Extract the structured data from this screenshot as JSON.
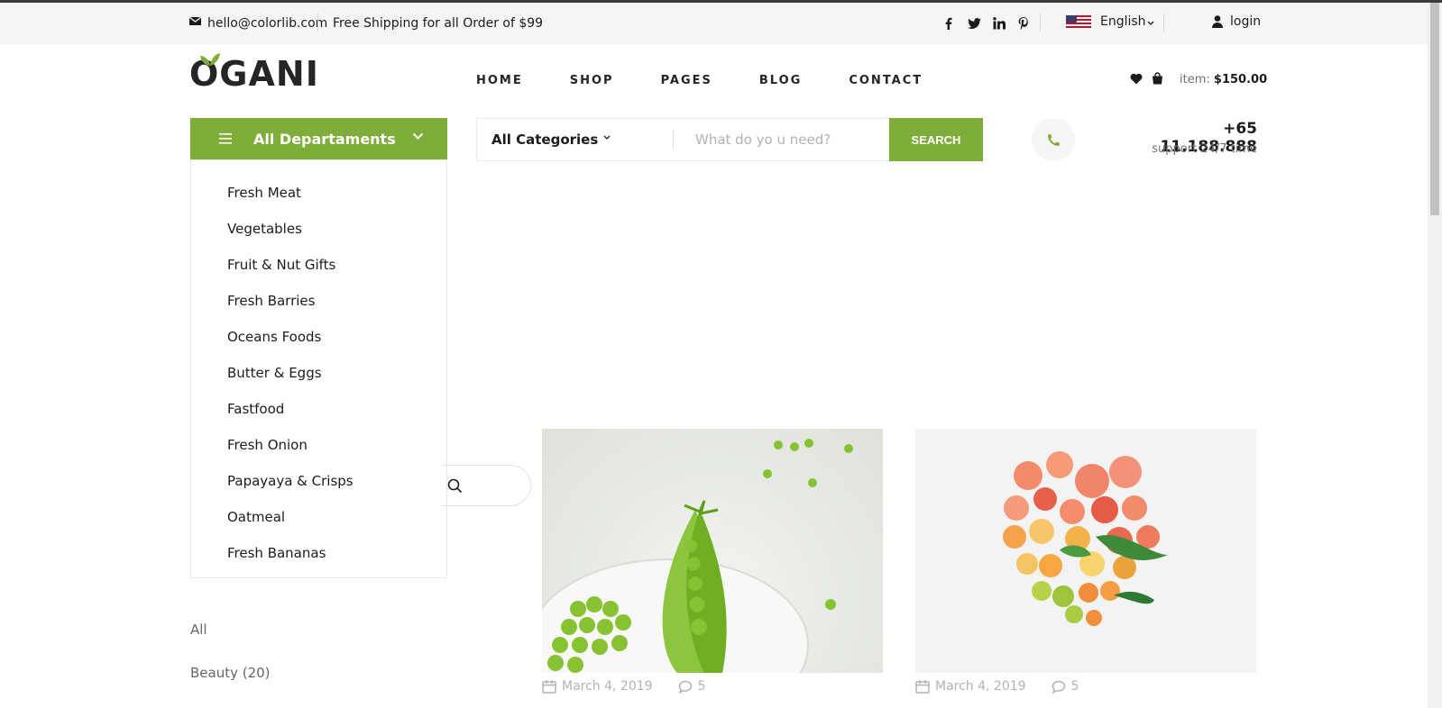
{
  "header_top": {
    "email": "hello@colorlib.com",
    "shipping": "Free Shipping for all Order of $99",
    "language": "English",
    "login": "login"
  },
  "logo": {
    "text": "OGANI"
  },
  "nav": [
    "HOME",
    "SHOP",
    "PAGES",
    "BLOG",
    "CONTACT"
  ],
  "cart": {
    "label": "item:",
    "total": "$150.00"
  },
  "departments": {
    "title": "All Departaments",
    "items": [
      "Fresh Meat",
      "Vegetables",
      "Fruit & Nut Gifts",
      "Fresh Barries",
      "Oceans Foods",
      "Butter & Eggs",
      "Fastfood",
      "Fresh Onion",
      "Papayaya & Crisps",
      "Oatmeal",
      "Fresh Bananas"
    ]
  },
  "search": {
    "category": "All Categories",
    "placeholder": "What do yo u need?",
    "button": "SEARCH"
  },
  "phone": {
    "number": "+65 11.188.888",
    "support": "support 24/7 time"
  },
  "sidebar": {
    "categories": [
      "All",
      "Beauty (20)"
    ]
  },
  "blog": [
    {
      "date": "March 4, 2019",
      "comments": "5"
    },
    {
      "date": "March 4, 2019",
      "comments": "5"
    }
  ],
  "colors": {
    "accent": "#7fad39",
    "text": "#1c1c1c",
    "muted": "#b2b2b2",
    "topbar": "#f5f5f5"
  }
}
